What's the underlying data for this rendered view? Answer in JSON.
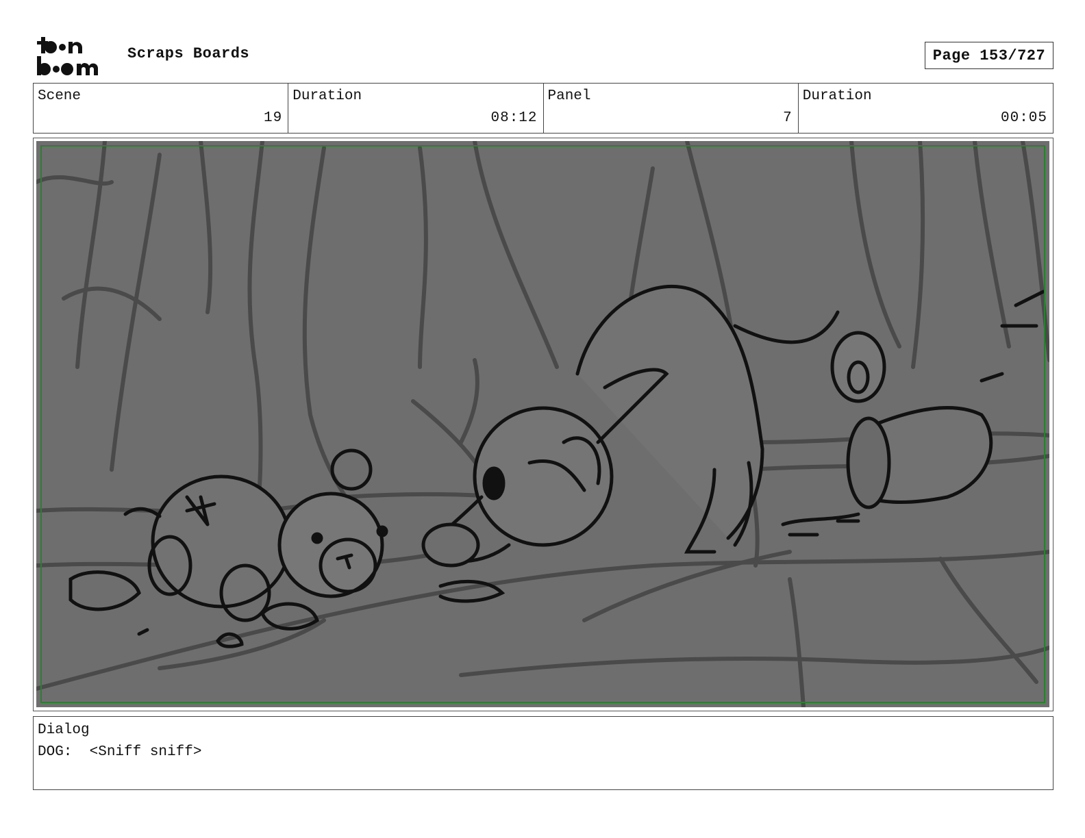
{
  "header": {
    "logo_text": "toon boom",
    "project_title": "Scraps Boards",
    "page_label": "Page 153/727"
  },
  "info": {
    "scene_label": "Scene",
    "scene_value": "19",
    "scene_duration_label": "Duration",
    "scene_duration_value": "08:12",
    "panel_label": "Panel",
    "panel_value": "7",
    "panel_duration_label": "Duration",
    "panel_duration_value": "00:05"
  },
  "dialog": {
    "label": "Dialog",
    "text": "DOG:  <Sniff sniff>"
  },
  "colors": {
    "panel_fill": "#6e6e6e",
    "safe_frame": "#2e7d32",
    "sketch_line": "#111111",
    "bg_line": "#4a4a4a"
  }
}
